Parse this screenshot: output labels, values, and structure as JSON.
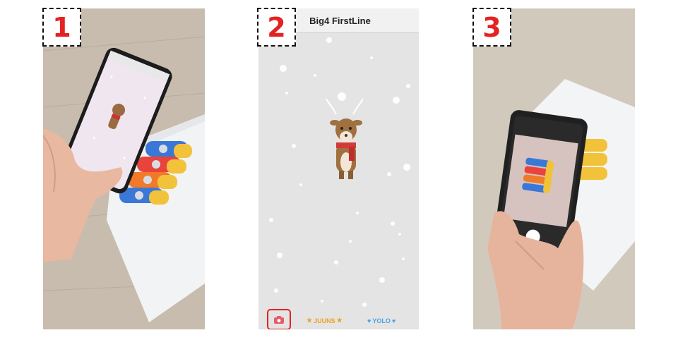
{
  "steps": [
    "1",
    "2",
    "3"
  ],
  "app": {
    "title": "Big4 FirstLine",
    "tabs": [
      {
        "label": "JUUNS",
        "icon": "star-icon"
      },
      {
        "label": "YOLO",
        "icon": "heart-icon"
      }
    ],
    "camera_button": {
      "icon": "camera-icon"
    }
  },
  "colors": {
    "step_number": "#e32222",
    "star": "#f0a020",
    "heart": "#4aa3e0"
  }
}
